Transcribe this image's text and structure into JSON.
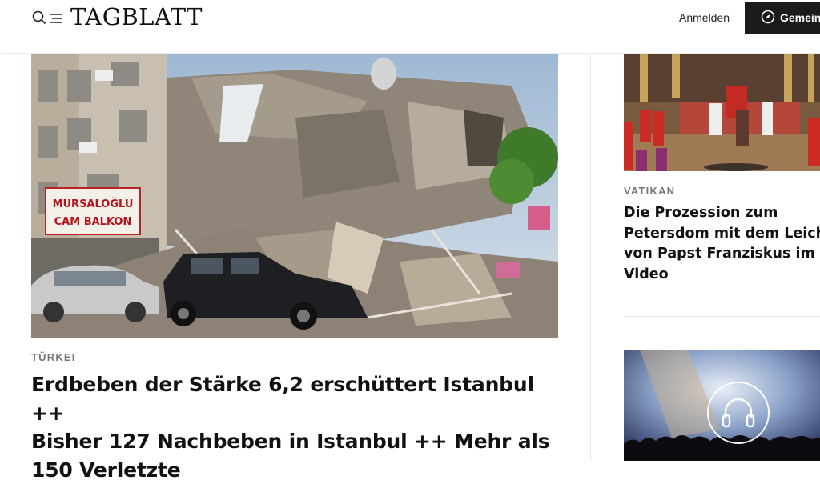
{
  "header": {
    "logo": "TAGBLATT",
    "login_label": "Anmelden",
    "cta_label": "Gemein",
    "icons": [
      "search-icon",
      "menu-icon",
      "compass-icon"
    ]
  },
  "main_article": {
    "kicker": "TÜRKEI",
    "headline_lines": [
      "Erdbeben der Stärke 6,2 erschüttert Istanbul ++",
      "Bisher 127 Nachbeben in Istanbul ++ Mehr als",
      "150 Verletzte"
    ],
    "image_sign_lines": [
      "MURSALOĞLU",
      "CAM BALKON"
    ]
  },
  "side_articles": [
    {
      "kicker": "VATIKAN",
      "headline_lines": [
        "Die Prozession zum",
        "Petersdom mit dem Leichnam",
        "von Papst Franziskus im",
        "Video"
      ]
    },
    {
      "icon": "headphones-icon"
    }
  ],
  "colors": {
    "kicker": "#767676",
    "cta_background": "#1b1b1b",
    "text": "#111111"
  }
}
